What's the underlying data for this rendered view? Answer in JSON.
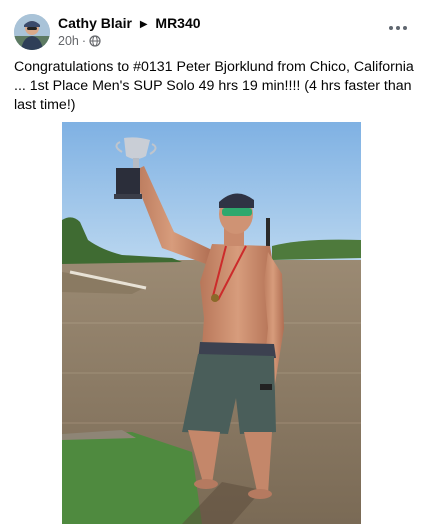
{
  "post": {
    "author": "Cathy Blair",
    "group": "MR340",
    "timestamp": "20h",
    "caption": "Congratulations to #0131 Peter Bjorklund from Chico, California ... 1st Place Men's SUP Solo 49 hrs 19 min!!!! (4 hrs faster than last time!)"
  },
  "icons": {
    "avatar": "user-avatar",
    "separator": "triangle-right-icon",
    "privacy": "globe-icon",
    "menu": "more-horizontal-icon"
  },
  "colors": {
    "text_primary": "#050505",
    "text_secondary": "#65676b",
    "background": "#ffffff"
  }
}
